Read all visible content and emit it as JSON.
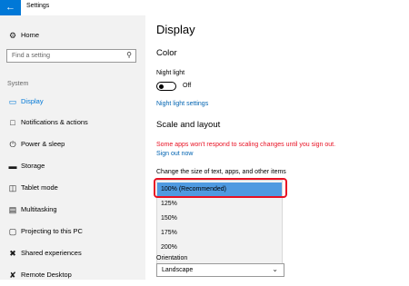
{
  "window": {
    "title": "Settings"
  },
  "sidebar": {
    "home": "Home",
    "search_placeholder": "Find a setting",
    "section": "System",
    "items": [
      {
        "label": "Display",
        "icon": "display-icon"
      },
      {
        "label": "Notifications & actions",
        "icon": "notifications-icon"
      },
      {
        "label": "Power & sleep",
        "icon": "power-icon"
      },
      {
        "label": "Storage",
        "icon": "storage-icon"
      },
      {
        "label": "Tablet mode",
        "icon": "tablet-icon"
      },
      {
        "label": "Multitasking",
        "icon": "multitasking-icon"
      },
      {
        "label": "Projecting to this PC",
        "icon": "projecting-icon"
      },
      {
        "label": "Shared experiences",
        "icon": "shared-icon"
      },
      {
        "label": "Remote Desktop",
        "icon": "remote-icon"
      }
    ]
  },
  "main": {
    "title": "Display",
    "color_heading": "Color",
    "night_light_label": "Night light",
    "night_light_state": "Off",
    "night_light_settings": "Night light settings",
    "scale_heading": "Scale and layout",
    "warning": "Some apps won't respond to scaling changes until you sign out.",
    "sign_out": "Sign out now",
    "scale_label": "Change the size of text, apps, and other items",
    "scale_options": [
      "100% (Recommended)",
      "125%",
      "150%",
      "175%",
      "200%"
    ],
    "scale_selected": "100% (Recommended)",
    "orientation_label": "Orientation",
    "orientation_value": "Landscape"
  },
  "colors": {
    "accent": "#0078d7",
    "warning": "#e81123",
    "highlight": "#e81123",
    "selected": "#4f9ae1"
  }
}
